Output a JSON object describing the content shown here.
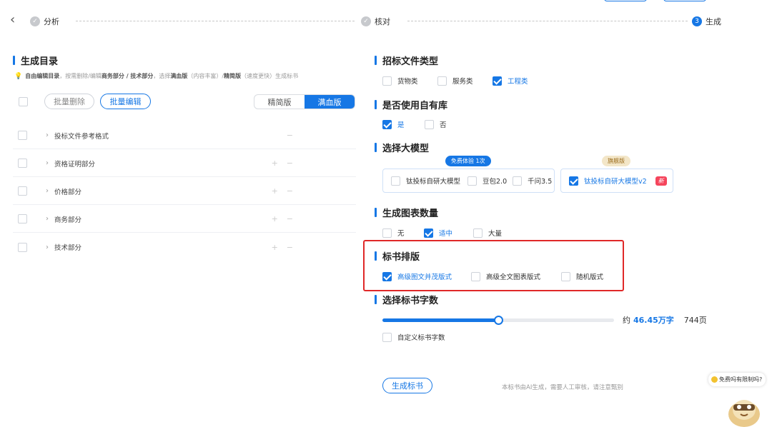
{
  "stepper": {
    "steps": [
      {
        "label": "分析",
        "badge": "✓"
      },
      {
        "label": "核对",
        "badge": "✓"
      },
      {
        "label": "生成",
        "badge": "3"
      }
    ]
  },
  "left": {
    "title": "生成目录",
    "hint_bold1": "自由编辑目录",
    "hint_text1": "，按需删除/编辑",
    "hint_bold2": "商务部分 / 技术部分",
    "hint_text2": "，选择",
    "hint_bold3": "满血版",
    "hint_text3": "（内容丰富）/",
    "hint_bold4": "精简版",
    "hint_text4": "（速度更快）生成标书",
    "batch_delete": "批量删除",
    "batch_edit": "批量编辑",
    "mode_simple": "精简版",
    "mode_full": "满血版",
    "rows": [
      {
        "label": "投标文件参考格式",
        "plus": "",
        "minus": "−"
      },
      {
        "label": "资格证明部分",
        "plus": "+",
        "minus": "−"
      },
      {
        "label": "价格部分",
        "plus": "+",
        "minus": "−"
      },
      {
        "label": "商务部分",
        "plus": "+",
        "minus": "−"
      },
      {
        "label": "技术部分",
        "plus": "+",
        "minus": "−"
      }
    ]
  },
  "right": {
    "doc_type": {
      "title": "招标文件类型",
      "options": [
        "货物类",
        "服务类",
        "工程类"
      ],
      "selected": "工程类"
    },
    "own_lib": {
      "title": "是否使用自有库",
      "options": [
        "是",
        "否"
      ],
      "selected": "是"
    },
    "model": {
      "title": "选择大模型",
      "free_tag": "免费体验 1次",
      "flagship_tag": "旗舰版",
      "free_options": [
        "钛投标自研大模型",
        "豆包2.0",
        "千问3.5"
      ],
      "flagship_option": "钛投标自研大模型v2",
      "new_badge": "新"
    },
    "charts": {
      "title": "生成图表数量",
      "options": [
        "无",
        "适中",
        "大量"
      ],
      "selected": "适中"
    },
    "layout": {
      "title": "标书排版",
      "options": [
        "高级图文并茂版式",
        "高级全文图表版式",
        "随机版式"
      ],
      "selected": "高级图文并茂版式"
    },
    "words": {
      "title": "选择标书字数",
      "slider_fraction": 0.5,
      "approx": "约",
      "value": "46.45万字",
      "pages": "744页",
      "custom_label": "自定义标书字数"
    },
    "generate_button": "生成标书",
    "disclaimer": "本标书由AI生成，需要人工审核，请注意甄别"
  },
  "assistant": {
    "bubble": "免费吗有限制吗?"
  },
  "colors": {
    "accent": "#1677e5",
    "highlight_box": "#e02828"
  }
}
